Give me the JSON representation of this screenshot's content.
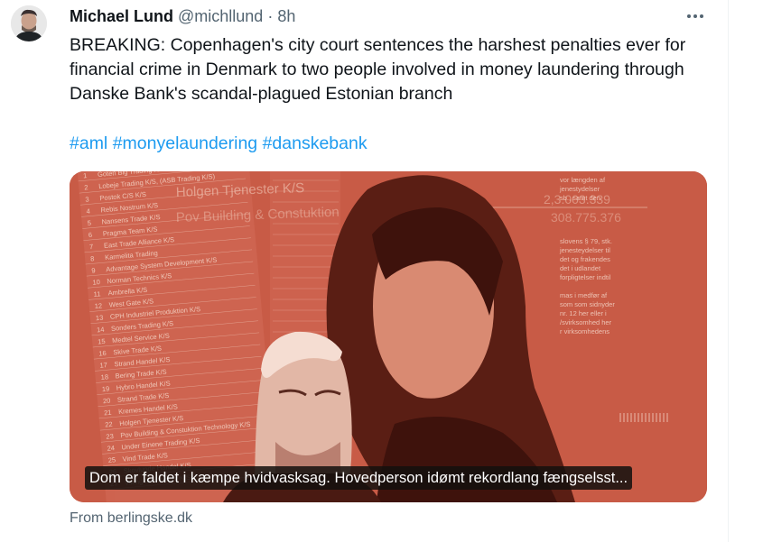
{
  "author": {
    "display_name": "Michael Lund",
    "handle": "@michllund",
    "separator": "·",
    "time": "8h"
  },
  "tweet": {
    "text": "BREAKING: Copenhagen's city court sentences the harshest penalties ever for financial crime in Denmark to two people involved in money laundering through Danske Bank's scandal-plagued Estonian branch",
    "hashtags": [
      "#aml",
      "#monyelaundering",
      "#danskebank"
    ]
  },
  "card": {
    "caption": "Dom er faldet i kæmpe hvidvasksag. Hovedperson idømt rekordlang fængselsst...",
    "source": "From berlingske.dk",
    "image_description_colors": {
      "background": "#c85b46",
      "dark_tone": "#4a1a12",
      "light_tone": "#f2c9b8"
    },
    "document_list": [
      "Goten Big Trading K/S",
      "Lobeje Trading K/S, (ASB Trading K/S)",
      "Postok C/S K/S",
      "Rebis Nostrum K/S",
      "Nansens Trade K/S",
      "Pragma Team K/S",
      "East Trade Alliance K/S",
      "Karmelita Trading",
      "Advantage System Development K/S",
      "Norman Technics K/S",
      "Ambrella K/S",
      "West Gate K/S",
      "CPH Industriel Produktion K/S",
      "Sonders Trading K/S",
      "Medtel Service K/S",
      "Skive Trade K/S",
      "Strand Handel K/S",
      "Bering Trade K/S",
      "Hybro Handel K/S",
      "Strand Trade K/S",
      "Kremes Handel K/S",
      "Holgen Tjenester K/S",
      "Pov Building & Constuktion Technology K/S",
      "Under Einene Trading K/S",
      "Vind Trade K/S",
      "Skovlunde Handel K/S",
      "Viking Investment K/S"
    ],
    "document_header_1": "Holgen Tjenester K/S",
    "document_header_2": "Pov Building & Constuktion",
    "right_text_lines": [
      "slovens § 79, stk.",
      "jenesteydelser til",
      "det og frakendes",
      "det i udlandet",
      "forpligtelser indtil",
      "mas i medfør af",
      "som som sidnyder",
      "nr. 12 her eller i",
      "/svirksomhed her",
      "r virksomhedens"
    ],
    "right_top_lines": [
      "vor længden af",
      "jenestydelser",
      "sb., samt den"
    ],
    "amount_1": "2,3.003.339",
    "amount_2": "308.775.376"
  }
}
